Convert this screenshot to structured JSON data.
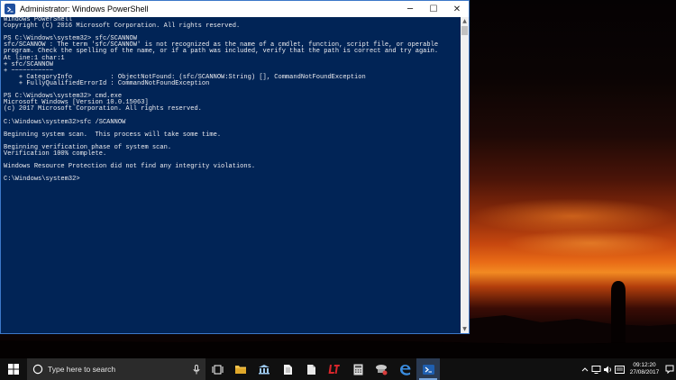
{
  "window": {
    "title": "Administrator: Windows PowerShell",
    "minimize_label": "─",
    "maximize_label": "☐",
    "close_label": "✕"
  },
  "console": {
    "lines": [
      "Windows PowerShell",
      "Copyright (C) 2016 Microsoft Corporation. All rights reserved.",
      "",
      "PS C:\\Windows\\system32> sfc/SCANNOW",
      "sfc/SCANNOW : The term 'sfc/SCANNOW' is not recognized as the name of a cmdlet, function, script file, or operable",
      "program. Check the spelling of the name, or if a path was included, verify that the path is correct and try again.",
      "At line:1 char:1",
      "+ sfc/SCANNOW",
      "+ ~~~~~~~~~~~",
      "    + CategoryInfo          : ObjectNotFound: (sfc/SCANNOW:String) [], CommandNotFoundException",
      "    + FullyQualifiedErrorId : CommandNotFoundException",
      "",
      "PS C:\\Windows\\system32> cmd.exe",
      "Microsoft Windows [Version 10.0.15063]",
      "(c) 2017 Microsoft Corporation. All rights reserved.",
      "",
      "C:\\Windows\\system32>sfc /SCANNOW",
      "",
      "Beginning system scan.  This process will take some time.",
      "",
      "Beginning verification phase of system scan.",
      "Verification 100% complete.",
      "",
      "Windows Resource Protection did not find any integrity violations.",
      "",
      "C:\\Windows\\system32>"
    ]
  },
  "taskbar": {
    "search_placeholder": "Type here to search",
    "clock_time": "09:12:20",
    "clock_date": "27/08/2017",
    "pinned_icons": [
      "task-view-icon",
      "file-explorer-icon",
      "library-icon",
      "document-icon",
      "blank-document-icon",
      "lt-app-icon",
      "calculator-icon",
      "network-app-icon",
      "edge-icon",
      "powershell-icon"
    ],
    "tray_icons": [
      "chevron-up-icon",
      "network-icon",
      "volume-icon",
      "language-icon"
    ],
    "accent_color": "#7aa7dd"
  },
  "colors": {
    "console_bg": "#012456",
    "console_fg": "#eeedf0",
    "window_border": "#3c78c8"
  }
}
